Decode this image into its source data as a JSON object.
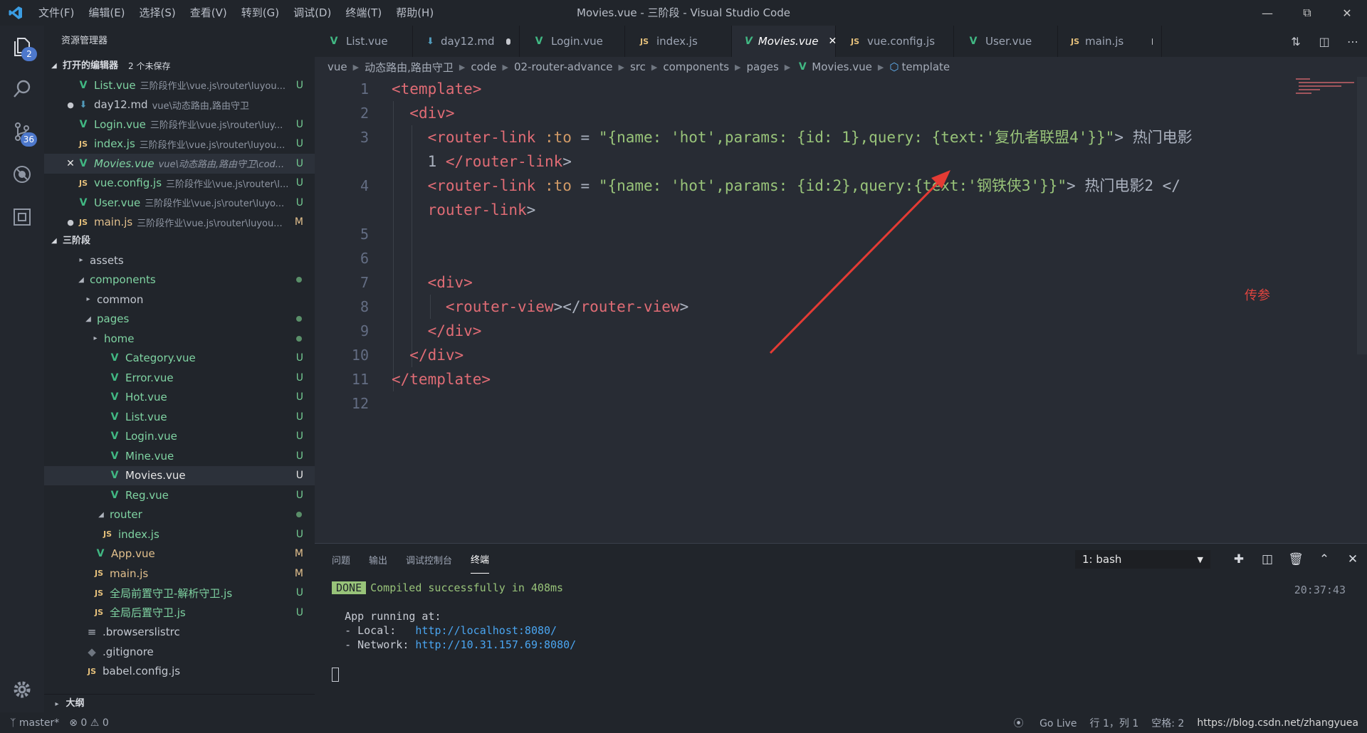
{
  "titlebar": {
    "menu": [
      "文件(F)",
      "编辑(E)",
      "选择(S)",
      "查看(V)",
      "转到(G)",
      "调试(D)",
      "终端(T)",
      "帮助(H)"
    ],
    "title": "Movies.vue - 三阶段 - Visual Studio Code"
  },
  "activity": {
    "explorer_badge": "2",
    "scm_badge": "36"
  },
  "sidebar": {
    "title": "资源管理器",
    "open_editors": {
      "label": "打开的编辑器",
      "count": "2 个未保存",
      "items": [
        {
          "name": "List.vue",
          "path": "三阶段作业\\vue.js\\router\\luyou...",
          "status": "U"
        },
        {
          "name": "day12.md",
          "path": "vue\\动态路由,路由守卫",
          "status": ""
        },
        {
          "name": "Login.vue",
          "path": "三阶段作业\\vue.js\\router\\luy...",
          "status": "U"
        },
        {
          "name": "index.js",
          "path": "三阶段作业\\vue.js\\router\\luyou...",
          "status": "U"
        },
        {
          "name": "Movies.vue",
          "path": "vue\\动态路由,路由守卫\\cod...",
          "status": "U"
        },
        {
          "name": "vue.config.js",
          "path": "三阶段作业\\vue.js\\router\\l...",
          "status": "U"
        },
        {
          "name": "User.vue",
          "path": "三阶段作业\\vue.js\\router\\luyo...",
          "status": "U"
        },
        {
          "name": "main.js",
          "path": "三阶段作业\\vue.js\\router\\luyou...",
          "status": "M"
        }
      ]
    },
    "folder": {
      "label": "三阶段",
      "items": [
        {
          "name": "assets"
        },
        {
          "name": "components"
        },
        {
          "name": "common"
        },
        {
          "name": "pages"
        },
        {
          "name": "home"
        },
        {
          "name": "Category.vue",
          "status": "U"
        },
        {
          "name": "Error.vue",
          "status": "U"
        },
        {
          "name": "Hot.vue",
          "status": "U"
        },
        {
          "name": "List.vue",
          "status": "U"
        },
        {
          "name": "Login.vue",
          "status": "U"
        },
        {
          "name": "Mine.vue",
          "status": "U"
        },
        {
          "name": "Movies.vue",
          "status": "U"
        },
        {
          "name": "Reg.vue",
          "status": "U"
        },
        {
          "name": "router"
        },
        {
          "name": "index.js",
          "status": "U"
        },
        {
          "name": "App.vue",
          "status": "M"
        },
        {
          "name": "main.js",
          "status": "M"
        },
        {
          "name": "全局前置守卫-解析守卫.js",
          "status": "U"
        },
        {
          "name": "全局后置守卫.js",
          "status": "U"
        },
        {
          "name": ".browserslistrc"
        },
        {
          "name": ".gitignore"
        },
        {
          "name": "babel.config.js"
        }
      ]
    },
    "outline": "大纲"
  },
  "tabs": [
    {
      "label": "List.vue"
    },
    {
      "label": "day12.md"
    },
    {
      "label": "Login.vue"
    },
    {
      "label": "index.js"
    },
    {
      "label": "Movies.vue"
    },
    {
      "label": "vue.config.js"
    },
    {
      "label": "User.vue"
    },
    {
      "label": "main.js"
    }
  ],
  "breadcrumb": [
    "vue",
    "动态路由,路由守卫",
    "code",
    "02-router-advance",
    "src",
    "components",
    "pages",
    "Movies.vue",
    "template"
  ],
  "editor": {
    "line_numbers": [
      "1",
      "2",
      "3",
      "",
      "4",
      "",
      "5",
      "6",
      "7",
      "8",
      "9",
      "10",
      "11",
      "12"
    ],
    "annotation": "传参",
    "lines": {
      "l1": {
        "tag": "<template>"
      },
      "l2": {
        "tag": "<div>"
      },
      "l3": {
        "open": "<router-link",
        "attr": " :to",
        "eq": " = ",
        "value": "\"{name: 'hot',params: {id: 1},query: {text:'复仇者联盟4'}}\"",
        "close": ">",
        "text": " 热门电影"
      },
      "l3w": {
        "text": "1 ",
        "endtag": "</router-link",
        "close": ">"
      },
      "l4": {
        "open": "<router-link",
        "attr": " :to",
        "eq": " = ",
        "value": "\"{name: 'hot',params: {id:2},query:{text:'钢铁侠3'}}\"",
        "close": ">",
        "text": " 热门电影2 </"
      },
      "l4w": {
        "endtag": "router-link",
        "close": ">"
      },
      "l7": {
        "tag": "<div>"
      },
      "l8": {
        "open": "<router-view",
        "mid": "></",
        "endtag": "router-view",
        "close": ">"
      },
      "l9": {
        "tag": "</div>"
      },
      "l10": {
        "tag": "</div>"
      },
      "l11": {
        "tag": "</template>"
      }
    }
  },
  "panel": {
    "tabs": [
      "问题",
      "输出",
      "调试控制台",
      "终端"
    ],
    "terminal_select": "1: bash",
    "done_label": "DONE",
    "compiled": "Compiled successfully in 408ms",
    "time": "20:37:43",
    "running": "App running at:",
    "local_label": "- Local:   ",
    "local_url": "http://localhost:8080/",
    "network_label": "- Network: ",
    "network_url": "http://10.31.157.69:8080/"
  },
  "statusbar": {
    "branch": "master*",
    "errors": "0",
    "warnings": "0",
    "golive": "Go Live",
    "position": "行 1，列 1",
    "spaces": "空格: 2",
    "watermark": "https://blog.csdn.net/zhangyuea"
  },
  "colors": {
    "tag": "#e06c75",
    "attr": "#d19a66",
    "string": "#98c379",
    "vue_icon": "#41b883",
    "js_icon": "#e5c07b",
    "annotation": "#e0453f"
  }
}
